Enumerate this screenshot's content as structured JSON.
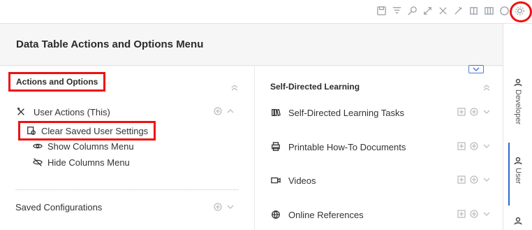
{
  "panel": {
    "title": "Data Table Actions and Options Menu"
  },
  "left": {
    "heading": "Actions and Options",
    "user_actions": {
      "label": "User Actions (This)",
      "items": [
        {
          "label": "Clear Saved User Settings",
          "icon": "clear-settings-icon"
        },
        {
          "label": "Show Columns Menu",
          "icon": "eye-icon"
        },
        {
          "label": "Hide Columns Menu",
          "icon": "eye-off-icon"
        }
      ]
    },
    "saved": {
      "label": "Saved Configurations"
    }
  },
  "right": {
    "heading": "Self-Directed Learning",
    "items": [
      {
        "label": "Self-Directed Learning Tasks",
        "icon": "books-icon"
      },
      {
        "label": "Printable How-To Documents",
        "icon": "printer-icon"
      },
      {
        "label": "Videos",
        "icon": "video-icon"
      },
      {
        "label": "Online References",
        "icon": "globe-icon"
      }
    ]
  },
  "side": {
    "developer": "Developer",
    "user": "User",
    "other": ""
  },
  "colors": {
    "highlight": "#ee1111",
    "accent": "#2a6bd1"
  }
}
